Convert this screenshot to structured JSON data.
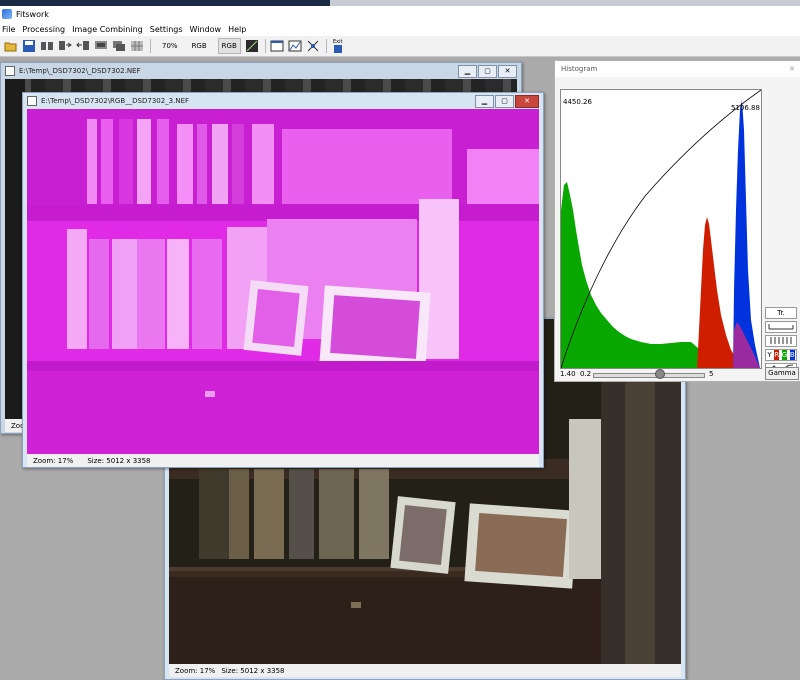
{
  "app": {
    "title": "Fitswork"
  },
  "menu": [
    "File",
    "Processing",
    "Image Combining",
    "Settings",
    "Window",
    "Help"
  ],
  "toolbar": {
    "zoom_label": "70%",
    "rgb1_label": "RGB",
    "rgb2_label": "RGB",
    "exit_label": "Exit"
  },
  "windows": {
    "back": {
      "title": "E:\\Temp\\_DSD7302\\_DSD7302.NEF",
      "status_zoom": "Zoo"
    },
    "front": {
      "title": "E:\\Temp\\_DSD7302\\RGB__DSD7302_3.NEF",
      "status_zoom": "Zoom: 17%",
      "status_size": "Size: 5012 x 3358"
    },
    "bottom": {
      "status_zoom": "Zoom: 17%",
      "status_size": "Size: 5012 x 3358"
    }
  },
  "histogram": {
    "title": "Histogram",
    "max_left": "4450.26",
    "max_right": "5106.88",
    "slider_left": "1.40",
    "slider_min": "0.2",
    "slider_max": "5",
    "side_label_tr": "Tr.",
    "y_label": "Y",
    "r_label": "R",
    "g_label": "G",
    "b_label": "B",
    "gamma_label": "Gamma"
  },
  "colors": {
    "magenta": "#e02ae6",
    "green": "#08a800",
    "red": "#cf1d00",
    "blue": "#0033dd"
  }
}
